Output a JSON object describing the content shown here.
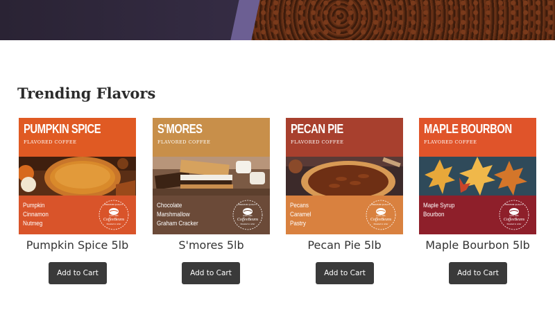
{
  "section": {
    "title": "Trending Flavors"
  },
  "products": [
    {
      "label_name": "Pumpkin Spice",
      "label_sub": "Flavored Coffee",
      "notes": [
        "Pumpkin",
        "Cinnamon",
        "Nutmeg"
      ],
      "badge_top": "PREMIUM QUALITY",
      "badge_brand": "CoffeeBeans",
      "badge_est": "ESTD 1986",
      "badge_tag": "Roasted to order",
      "title": "Pumpkin Spice 5lb",
      "button": "Add to Cart",
      "colors": {
        "top": "#e05a23",
        "bottom": "#d9542a"
      }
    },
    {
      "label_name": "S'mores",
      "label_sub": "Flavored Coffee",
      "notes": [
        "Chocolate",
        "Marshmallow",
        "Graham Cracker"
      ],
      "badge_top": "PREMIUM QUALITY",
      "badge_brand": "CoffeeBeans",
      "badge_est": "ESTD 1986",
      "badge_tag": "Roasted to order",
      "title": "S'mores 5lb",
      "button": "Add to Cart",
      "colors": {
        "top": "#c88f4a",
        "bottom": "#6b4a38"
      }
    },
    {
      "label_name": "Pecan Pie",
      "label_sub": "Flavored Coffee",
      "notes": [
        "Pecans",
        "Caramel",
        "Pastry"
      ],
      "badge_top": "PREMIUM QUALITY",
      "badge_brand": "CoffeeBeans",
      "badge_est": "ESTD 1986",
      "badge_tag": "Roasted to order",
      "title": "Pecan Pie 5lb",
      "button": "Add to Cart",
      "colors": {
        "top": "#a8402e",
        "bottom": "#d9813f"
      }
    },
    {
      "label_name": "Maple Bourbon",
      "label_sub": "Flavored Coffee",
      "notes": [
        "Maple Syrup",
        "Bourbon"
      ],
      "badge_top": "PREMIUM QUALITY",
      "badge_brand": "CoffeeBeans",
      "badge_est": "ESTD 1986",
      "badge_tag": "Roasted to order",
      "title": "Maple Bourbon 5lb",
      "button": "Add to Cart",
      "colors": {
        "top": "#e0542a",
        "bottom": "#8e1f2a"
      }
    }
  ]
}
